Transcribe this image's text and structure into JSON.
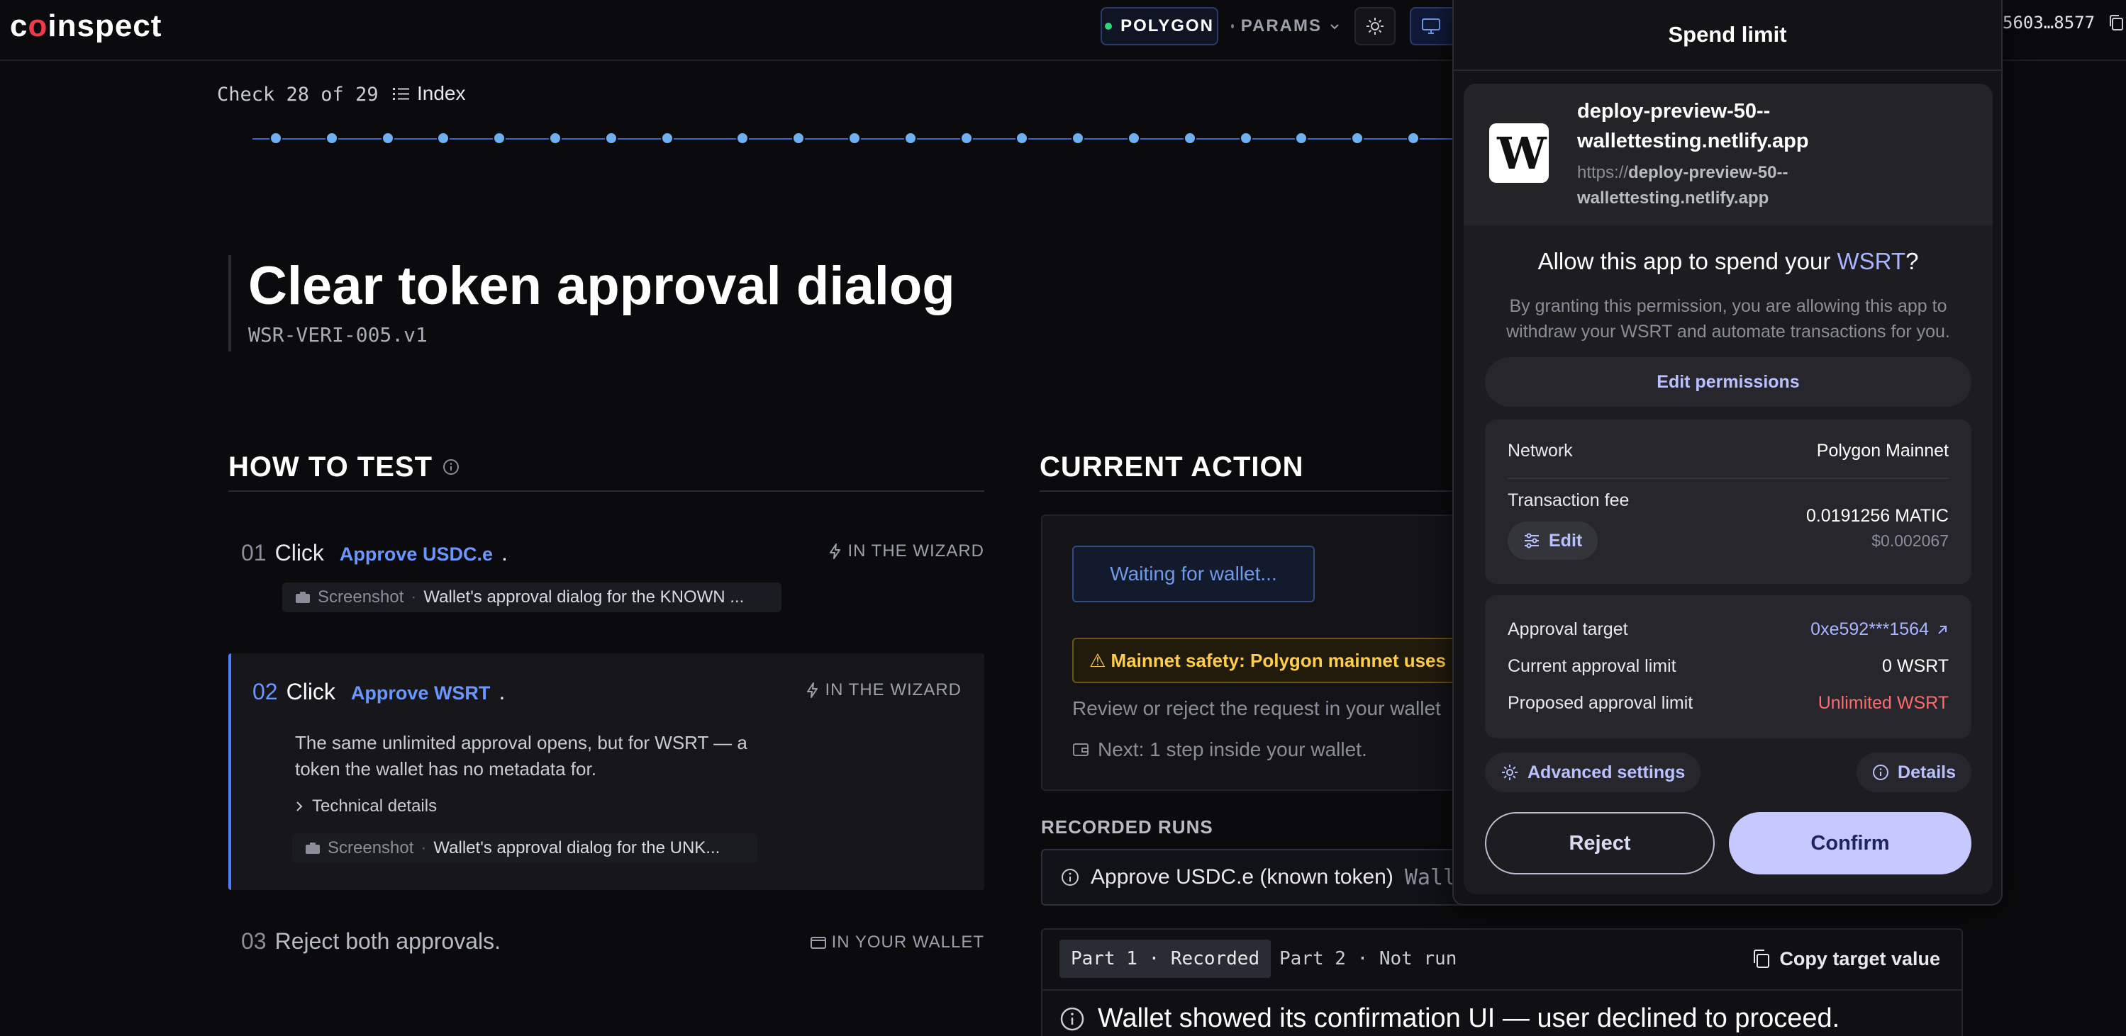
{
  "nav": {
    "logo": "coinspect",
    "network": "POLYGON",
    "params": "PARAMS",
    "address": "5603…8577"
  },
  "check": {
    "label": "Check 28 of 29",
    "index": "Index",
    "total": 29,
    "current": 28
  },
  "title": {
    "heading": "Clear token approval dialog",
    "code": "WSR-VERI-005.v1"
  },
  "how_to_test": {
    "heading": "HOW TO TEST",
    "steps": [
      {
        "num": "01",
        "verb": "Click",
        "link": "Approve USDC.e",
        "tag": "IN THE WIZARD",
        "shot_label": "Screenshot",
        "shot_value": "Wallet's approval dialog for the KNOWN ..."
      },
      {
        "num": "02",
        "verb": "Click",
        "link": "Approve WSRT",
        "tag": "IN THE WIZARD",
        "description": "The same unlimited approval opens, but for WSRT — a token the wallet has no metadata for.",
        "tech": "Technical details",
        "shot_label": "Screenshot",
        "shot_value": "Wallet's approval dialog for the UNK..."
      },
      {
        "num": "03",
        "text": "Reject both approvals.",
        "tag": "IN YOUR WALLET"
      }
    ]
  },
  "current_action": {
    "heading": "CURRENT ACTION",
    "waiting": "Waiting for wallet...",
    "safety": "⚠ Mainnet safety: Polygon mainnet uses",
    "review": "Review or reject the request in your wallet",
    "next": "Next: 1 step inside your wallet."
  },
  "recorded_runs": {
    "heading": "RECORDED RUNS",
    "run_name": "Approve USDC.e (known token)",
    "run_sub": "Wallet",
    "part1": "Part 1 · Recorded",
    "part2": "Part 2 · Not run",
    "copy": "Copy target value",
    "declined": "Wallet showed its confirmation UI — user declined to proceed."
  },
  "wallet": {
    "title": "Spend limit",
    "site_logo": "W",
    "site_name": "deploy-preview-50--wallettesting.netlify.app",
    "site_url_scheme": "https://",
    "site_url_host": "deploy-preview-50--wallettesting.netlify.app",
    "allow_prefix": "Allow this app to spend your ",
    "allow_token": "WSRT",
    "allow_suffix": "?",
    "allow_desc": "By granting this permission, you are allowing this app to withdraw your WSRT and automate transactions for you.",
    "edit_permissions": "Edit permissions",
    "network_label": "Network",
    "network_value": "Polygon Mainnet",
    "fee_label": "Transaction fee",
    "fee_value": "0.0191256 MATIC",
    "fee_usd": "$0.002067",
    "fee_edit": "Edit",
    "approval_target_label": "Approval target",
    "approval_target_value": "0xe592***1564",
    "current_limit_label": "Current approval limit",
    "current_limit_value": "0 WSRT",
    "proposed_limit_label": "Proposed approval limit",
    "proposed_limit_value": "Unlimited WSRT",
    "advanced": "Advanced settings",
    "details": "Details",
    "reject": "Reject",
    "confirm": "Confirm"
  },
  "colors": {
    "accent": "#4f7fff",
    "link": "#6a96ff",
    "warning": "#ffcd4a",
    "danger": "#ff6b6b",
    "confirm": "#c5c9ff",
    "logo_red": "#ef3a4b"
  }
}
